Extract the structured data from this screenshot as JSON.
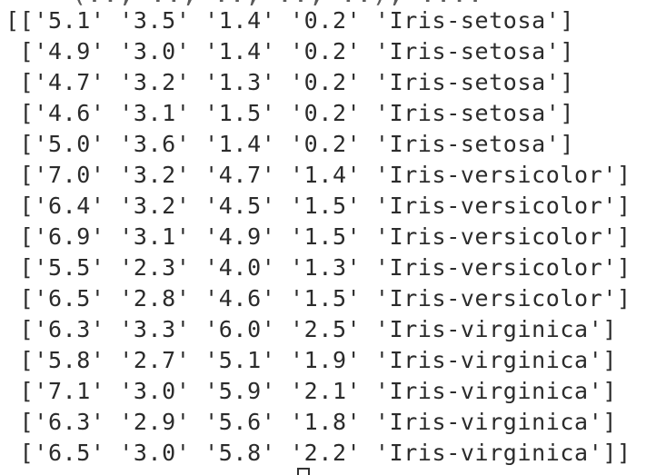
{
  "output": {
    "partial_top_line": "    (.., .., .., .., ..), ....  ",
    "lines": [
      "[['5.1' '3.5' '1.4' '0.2' 'Iris-setosa']",
      " ['4.9' '3.0' '1.4' '0.2' 'Iris-setosa']",
      " ['4.7' '3.2' '1.3' '0.2' 'Iris-setosa']",
      " ['4.6' '3.1' '1.5' '0.2' 'Iris-setosa']",
      " ['5.0' '3.6' '1.4' '0.2' 'Iris-setosa']",
      " ['7.0' '3.2' '4.7' '1.4' 'Iris-versicolor']",
      " ['6.4' '3.2' '4.5' '1.5' 'Iris-versicolor']",
      " ['6.9' '3.1' '4.9' '1.5' 'Iris-versicolor']",
      " ['5.5' '2.3' '4.0' '1.3' 'Iris-versicolor']",
      " ['6.5' '2.8' '4.6' '1.5' 'Iris-versicolor']",
      " ['6.3' '3.3' '6.0' '2.5' 'Iris-virginica']",
      " ['5.8' '2.7' '5.1' '1.9' 'Iris-virginica']",
      " ['7.1' '3.0' '5.9' '2.1' 'Iris-virginica']",
      " ['6.3' '2.9' '5.6' '1.8' 'Iris-virginica']",
      " ['6.5' '3.0' '5.8' '2.2' 'Iris-virginica']]"
    ]
  }
}
